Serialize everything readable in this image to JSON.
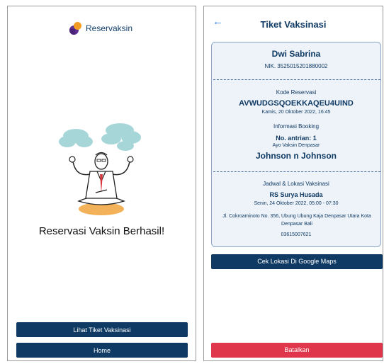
{
  "left": {
    "brand": "Reservaksin",
    "success_title": "Reservasi Vaksin Berhasil!",
    "view_ticket_label": "Lihat Tiket Vaksinasi",
    "home_label": "Home"
  },
  "right": {
    "title": "Tiket Vaksinasi",
    "name": "Dwi Sabrina",
    "nik": "NIK. 3525015201880002",
    "reservation_code_label": "Kode Reservasi",
    "reservation_code": "AVWUDGSQOEKKAQEU4UIND",
    "reservation_datetime": "Kamis, 20 Oktober 2022, 16:45",
    "booking_info_label": "Informasi Booking",
    "queue_number": "No. antrian: 1",
    "program": "Ayo Vaksin Denpasar",
    "vaccine": "Johnson n Johnson",
    "schedule_label": "Jadwal & Lokasi Vaksinasi",
    "location_name": "RS Surya Husada",
    "schedule": "Senin, 24 Oktober 2022, 05:00 - 07:30",
    "address": "Jl. Cokroaminoto No. 356, Ubung Ubung Kaja Denpasar Utara Kota Denpasar Bali",
    "phone": "03615007621",
    "maps_label": "Cek Lokasi Di Google Maps",
    "cancel_label": "Batalkan"
  },
  "colors": {
    "primary": "#0f3a63",
    "accent": "#2d7de0",
    "danger": "#e0364b",
    "logo_purple": "#5c2d91",
    "logo_orange": "#f39c24"
  },
  "icons": {
    "back": "arrow-left-icon",
    "logo": "reservaksin-logo"
  }
}
